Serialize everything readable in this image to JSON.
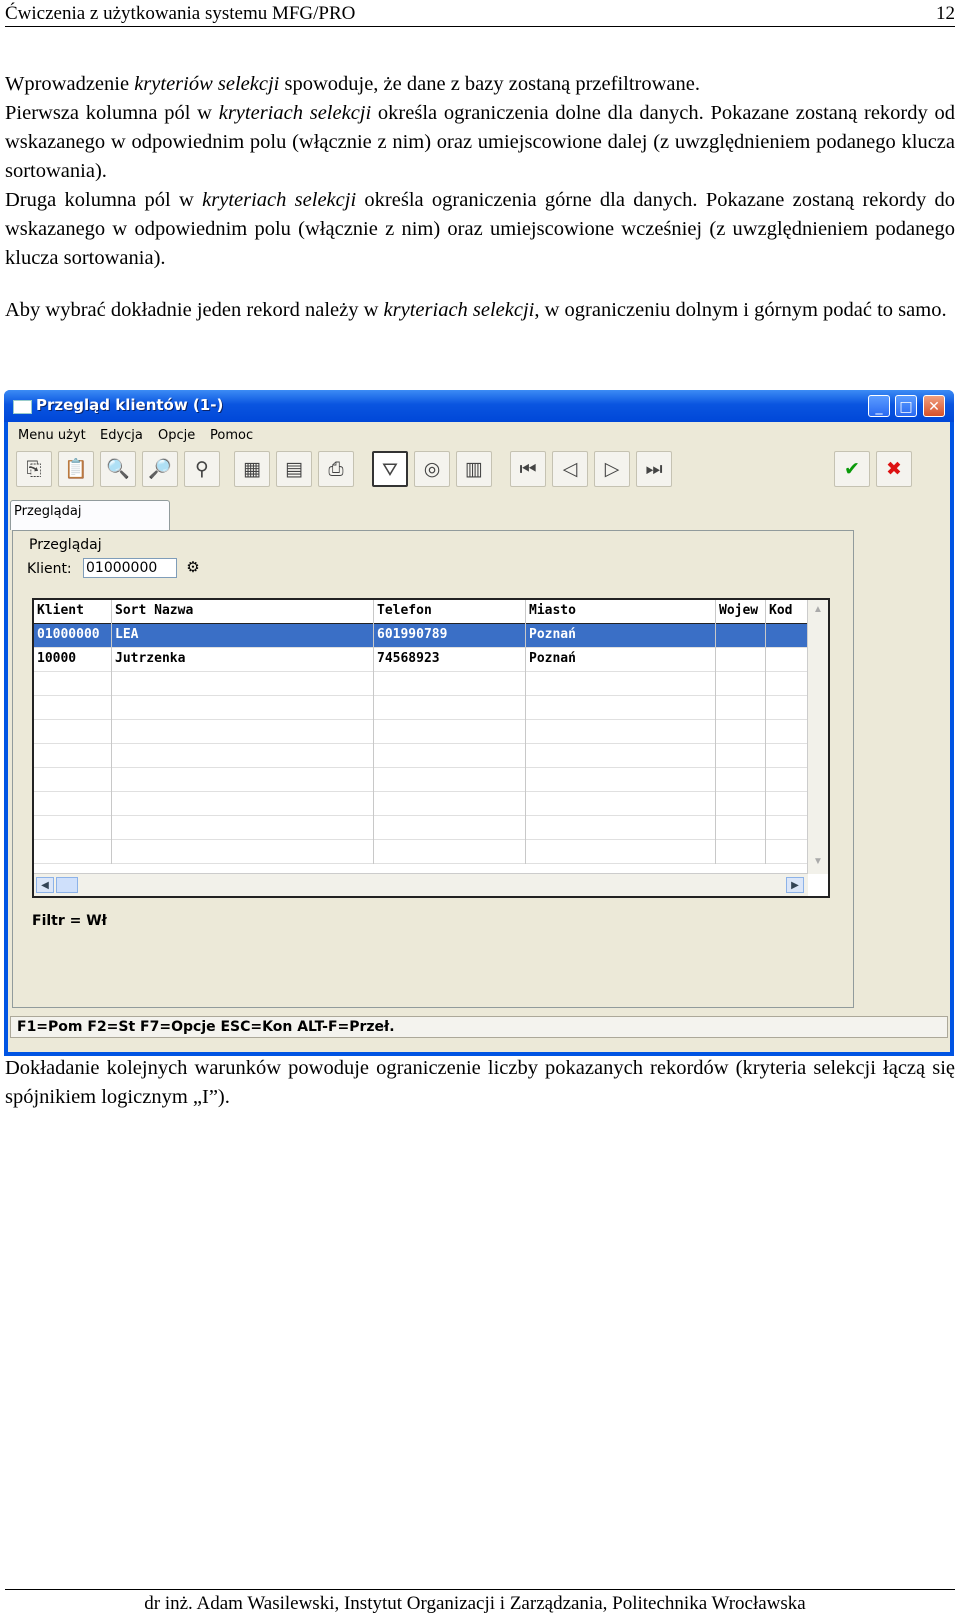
{
  "header": {
    "title": "Ćwiczenia z użytkowania systemu MFG/PRO",
    "page_number": "12"
  },
  "intro": {
    "p1": [
      {
        "t": "Wprowadzenie "
      },
      {
        "t": "kryteriów selekcji",
        "i": true
      },
      {
        "t": " spowoduje, że dane z bazy zostaną przefiltrowane."
      }
    ],
    "p2": [
      {
        "t": "Pierwsza kolumna pól w "
      },
      {
        "t": "kryteriach selekcji",
        "i": true
      },
      {
        "t": " określa ograniczenia dolne dla danych. Pokazane zostaną rekordy od wskazanego w odpowiednim polu (włącznie z nim) oraz umiejscowione dalej (z uwzględnieniem podanego klucza sortowania)."
      }
    ],
    "p3": [
      {
        "t": "Druga kolumna pól w "
      },
      {
        "t": "kryteriach selekcji",
        "i": true
      },
      {
        "t": " określa ograniczenia górne dla danych. Pokazane zostaną rekordy do wskazanego w odpowiednim polu (włącznie z nim) oraz umiejscowione wcześniej (z uwzględnieniem podanego klucza sortowania)."
      }
    ],
    "p4": [
      {
        "t": "Aby wybrać dokładnie jeden rekord należy w "
      },
      {
        "t": "kryteriach selekcji",
        "i": true
      },
      {
        "t": ", w ograniczeniu dolnym i górnym podać to samo."
      }
    ]
  },
  "window": {
    "title": "Przegląd klientów (1-)",
    "menu": [
      "Menu użyt",
      "Edycja",
      "Opcje",
      "Pomoc"
    ],
    "tab_label": "Przeglądaj",
    "group_label": "Przeglądaj",
    "klient_label": "Klient:",
    "klient_value": "01000000",
    "columns": [
      "Klient",
      "Sort Nazwa",
      "Telefon",
      "Miasto",
      "Wojew",
      "Kod"
    ],
    "rows": [
      [
        "01000000",
        "LEA",
        "601990789",
        "Poznań",
        "",
        ""
      ],
      [
        "10000",
        "Jutrzenka",
        "74568923",
        "Poznań",
        "",
        ""
      ]
    ],
    "selected_row": 0,
    "filter_text": "Filtr = Wł",
    "status_text": "F1=Pom F2=St F7=Opcje ESC=Kon ALT-F=Przeł."
  },
  "outro": {
    "p1": "Dokładanie kolejnych warunków powoduje ograniczenie liczby pokazanych rekordów (kryteria selekcji łączą się spójnikiem logicznym „I”)."
  },
  "footer": {
    "text": "dr inż. Adam Wasilewski, Instytut Organizacji i Zarządzania, Politechnika Wrocławska"
  },
  "icons": {
    "toolbar": [
      "copy-icon",
      "paste-icon",
      "find-icon",
      "find-next-icon",
      "find-prev-icon",
      "calculator-icon",
      "calendar-icon",
      "print-icon",
      "filter-icon",
      "binoculars-icon",
      "chart-icon",
      "first-record-icon",
      "prev-record-icon",
      "next-record-icon",
      "last-record-icon",
      "ok-icon",
      "cancel-icon"
    ]
  },
  "colors": {
    "titlebar": "#0054e3",
    "selected_row": "#3a6fc6",
    "ok": "#0a9a0a",
    "cancel": "#dd1111"
  }
}
